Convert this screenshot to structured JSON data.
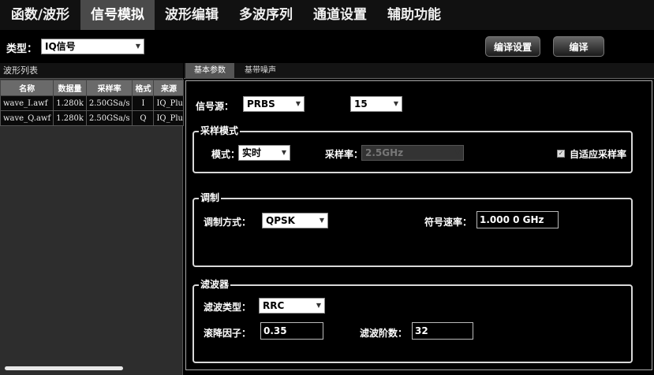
{
  "tabs": [
    {
      "label": "函数/波形"
    },
    {
      "label": "信号模拟"
    },
    {
      "label": "波形编辑"
    },
    {
      "label": "多波序列"
    },
    {
      "label": "通道设置"
    },
    {
      "label": "辅助功能"
    }
  ],
  "toolbar": {
    "type_label": "类型：",
    "type_value": "IQ信号",
    "compile_settings": "编译设置",
    "compile": "编译"
  },
  "wave_list": {
    "title": "波形列表",
    "columns": [
      "名称",
      "数据量",
      "采样率",
      "格式",
      "来源"
    ],
    "rows": [
      [
        "wave_I.awf",
        "1.280k",
        "2.50GSa/s",
        "I",
        "IQ_Plug"
      ],
      [
        "wave_Q.awf",
        "1.280k",
        "2.50GSa/s",
        "Q",
        "IQ_Plug"
      ]
    ]
  },
  "subtabs": {
    "basic": "基本参数",
    "baseband_noise": "基带噪声"
  },
  "signal_source": {
    "label": "信号源：",
    "value": "PRBS",
    "order": "15"
  },
  "sampling": {
    "title": "采样模式",
    "mode_label": "模式：",
    "mode_value": "实时",
    "rate_label": "采样率：",
    "rate_value": "2.5GHz",
    "adaptive_label": "自适应采样率",
    "adaptive_checked": true
  },
  "modulation": {
    "title": "调制",
    "type_label": "调制方式：",
    "type_value": "QPSK",
    "symbol_rate_label": "符号速率：",
    "symbol_rate_value": "1.000 0 GHz"
  },
  "filter": {
    "title": "滤波器",
    "type_label": "滤波类型：",
    "type_value": "RRC",
    "rolloff_label": "滚降因子：",
    "rolloff_value": "0.35",
    "order_label": "滤波阶数：",
    "order_value": "32"
  }
}
